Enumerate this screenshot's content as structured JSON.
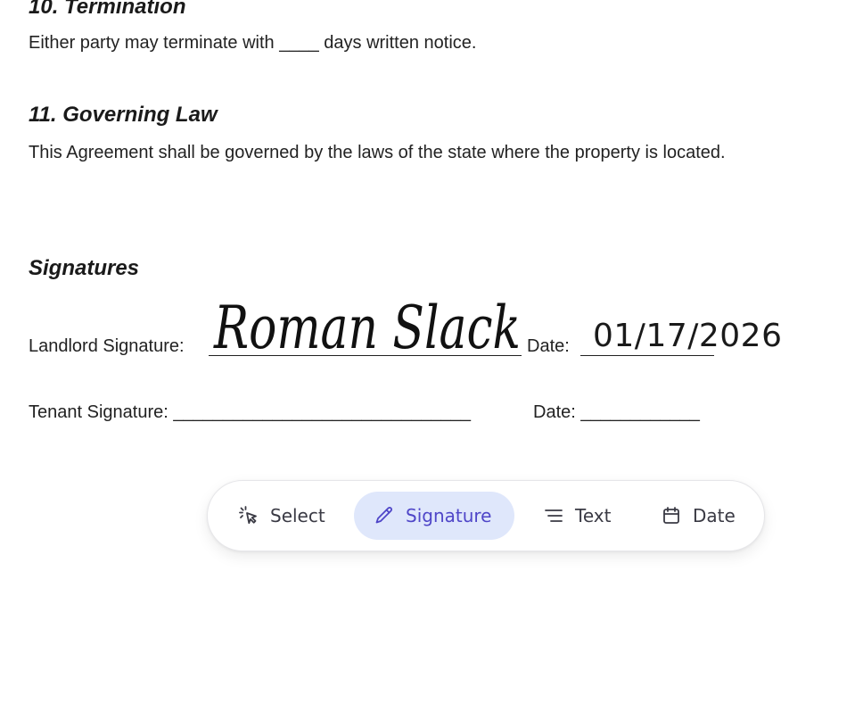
{
  "document": {
    "sections": [
      {
        "heading": "10. Termination",
        "body": "Either party may terminate with ____ days written notice."
      },
      {
        "heading": "11. Governing Law",
        "body": "This Agreement shall be governed by the laws of the state where the property is located."
      }
    ],
    "signatures": {
      "heading": "Signatures",
      "landlord": {
        "label": "Landlord Signature:",
        "signature_text": "Roman Slack",
        "date_label": "Date:",
        "date_value": "01/17/2026"
      },
      "tenant": {
        "label": "Tenant Signature: ______________________________",
        "date_label": "Date: ____________"
      }
    }
  },
  "toolbar": {
    "tools": [
      {
        "label": "Select",
        "icon": "select-cursor-icon",
        "active": false
      },
      {
        "label": "Signature",
        "icon": "pencil-icon",
        "active": true
      },
      {
        "label": "Text",
        "icon": "text-lines-icon",
        "active": false
      },
      {
        "label": "Date",
        "icon": "calendar-icon",
        "active": false
      }
    ],
    "colors": {
      "active_bg": "#dfe7fb",
      "active_fg": "#4f46c8",
      "inactive_fg": "#3a3a44"
    }
  }
}
